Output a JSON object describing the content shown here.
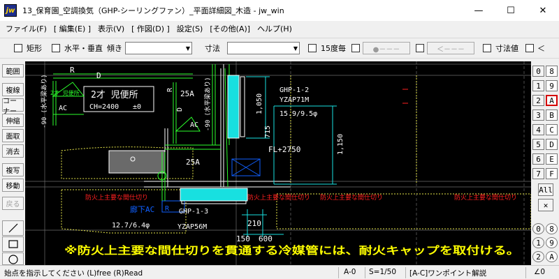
{
  "window": {
    "title": "13_保育園_空調換気（GHP-シーリングファン）_平面詳細図_木造 - jw_win",
    "app_icon": "jw",
    "minimize": "—",
    "maximize": "☐",
    "close": "✕"
  },
  "menu": [
    "ファイル(F)",
    "[ 編集(E) ]",
    "表示(V)",
    "[ 作図(D) ]",
    "設定(S)",
    "[その他(A)]",
    "ヘルプ(H)"
  ],
  "toolbar": {
    "rect_label": "矩形",
    "hv_label": "水平・垂直",
    "tilt_label": "傾き",
    "dim_label": "寸法",
    "deg15_label": "15度毎",
    "btn_a": "●－－－",
    "btn_b": "＜－－－",
    "dimval_label": "寸法値",
    "last_label": "＜"
  },
  "left_tools": [
    "範囲",
    "複線",
    "コーナー",
    "伸縮",
    "面取",
    "消去",
    "複写",
    "移動",
    "戻る"
  ],
  "shape_tools": [
    "line-tool",
    "rect-tool",
    "circle-tool"
  ],
  "right_layers": {
    "groups": [
      [
        "0",
        "8"
      ],
      [
        "1",
        "9"
      ],
      [
        "2",
        "A"
      ],
      [
        "3",
        "B"
      ],
      [
        "4",
        "C"
      ],
      [
        "5",
        "D"
      ],
      [
        "6",
        "E"
      ],
      [
        "7",
        "F"
      ]
    ],
    "all_label": "All",
    "x_label": "✕",
    "layer_groups_bottom": [
      [
        "0",
        "8"
      ],
      [
        "1",
        "9"
      ],
      [
        "2",
        "A"
      ]
    ]
  },
  "drawing": {
    "labels": {
      "R_top": "R",
      "D_top": "D",
      "toilet_small": "2才 児便所",
      "AC_left": "AC",
      "room_name": "2才 児便所",
      "ch": "CH=2400",
      "level": "±0",
      "vert_left": "-90 (水平梁あり)",
      "vert_mid": "-90 (水平梁あり)",
      "pipe_25A_1": "25A",
      "pipe_25A_2": "25A",
      "R_mid": "R",
      "D_mid": "D",
      "AC_mid": "AC",
      "dim_1050": "1,050",
      "dim_715": "715",
      "dim_1150": "1,150",
      "unit1_name": "GHP-1-2",
      "unit1_model": "YZAP71M",
      "unit1_pipe": "15.9/9.5φ",
      "fl": "FL+2750",
      "firewall_1": "防火上主要な間仕切り",
      "firewall_2": "防火上主要な間仕切り",
      "firewall_3": "防火上主要な間仕切り",
      "firewall_4": "防火上主要な間仕切り",
      "corridor_ac": "廊下AC",
      "R_low": "R",
      "unit2_name": "GHP-1-3",
      "unit2_model": "YZAP56M",
      "unit2_pipe": "12.7/6.4φ",
      "dim_210": "210",
      "dim_150": "150",
      "dim_600": "600",
      "note": "※防火上主要な間仕切りを貫通する冷媒管には、耐火キャップを取付ける。"
    }
  },
  "status": {
    "message": "始点を指示してください (L)free (R)Read",
    "layer": "A-0",
    "scale": "S=1/50",
    "tip": "[A-C]ワンポイント解説",
    "angle": "∠0"
  }
}
